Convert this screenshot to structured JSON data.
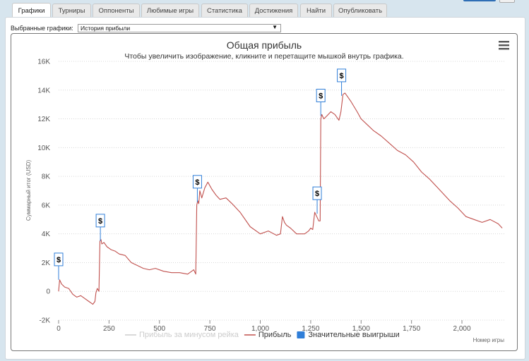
{
  "tabs": [
    {
      "label": "Графики",
      "active": true
    },
    {
      "label": "Турниры",
      "active": false
    },
    {
      "label": "Оппоненты",
      "active": false
    },
    {
      "label": "Любимые игры",
      "active": false
    },
    {
      "label": "Статистика",
      "active": false
    },
    {
      "label": "Достижения",
      "active": false
    },
    {
      "label": "Найти",
      "active": false
    },
    {
      "label": "Опубликовать",
      "active": false
    }
  ],
  "selector": {
    "label": "Выбранные графики:",
    "value": "История прибыли"
  },
  "colors": {
    "profit_line": "#c0504d",
    "rake_line": "#cccccc",
    "big_wins": "#2f7ed8",
    "tab_bg": "#e9e9e9",
    "page_bg": "#d7e5ee"
  },
  "chart_data": {
    "type": "line",
    "title": "Общая прибыль",
    "subtitle": "Чтобы увеличить изображение, кликните и перетащите мышкой внутрь графика.",
    "xlabel": "Номер игры",
    "ylabel": "Суммарный итог (USD)",
    "xlim": [
      0,
      2210
    ],
    "ylim": [
      -2000,
      16000
    ],
    "x_ticks": [
      0,
      250,
      500,
      750,
      1000,
      1250,
      1500,
      1750,
      2000
    ],
    "x_tick_labels": [
      "0",
      "250",
      "500",
      "750",
      "1,000",
      "1,250",
      "1,500",
      "1,750",
      "2,000"
    ],
    "y_ticks": [
      -2000,
      0,
      2000,
      4000,
      6000,
      8000,
      10000,
      12000,
      14000,
      16000
    ],
    "y_tick_labels": [
      "-2K",
      "0",
      "2K",
      "4K",
      "6K",
      "8K",
      "10K",
      "12K",
      "14K",
      "16K"
    ],
    "grid": true,
    "legend_position": "bottom",
    "legend": [
      {
        "name": "Прибыль за минусом рейка",
        "style": "line",
        "color": "#cccccc",
        "muted": true
      },
      {
        "name": "Прибыль",
        "style": "line",
        "color": "#c0504d",
        "muted": false
      },
      {
        "name": "Значительные выигрыши",
        "style": "square",
        "color": "#2f7ed8",
        "muted": false
      }
    ],
    "series": [
      {
        "name": "Прибыль",
        "x": [
          0,
          5,
          15,
          30,
          50,
          70,
          90,
          110,
          130,
          150,
          170,
          180,
          185,
          192,
          200,
          205,
          210,
          214,
          225,
          240,
          260,
          280,
          300,
          330,
          360,
          390,
          420,
          450,
          480,
          520,
          560,
          600,
          640,
          670,
          680,
          685,
          690,
          695,
          700,
          710,
          725,
          740,
          760,
          780,
          800,
          830,
          860,
          900,
          950,
          1000,
          1040,
          1080,
          1100,
          1110,
          1120,
          1130,
          1150,
          1180,
          1220,
          1240,
          1250,
          1260,
          1270,
          1280,
          1290,
          1297,
          1300,
          1305,
          1315,
          1330,
          1350,
          1370,
          1390,
          1395,
          1400,
          1410,
          1420,
          1430,
          1450,
          1480,
          1500,
          1530,
          1560,
          1600,
          1640,
          1680,
          1720,
          1760,
          1800,
          1840,
          1880,
          1900,
          1940,
          1980,
          2020,
          2060,
          2100,
          2140,
          2180,
          2200
        ],
        "y": [
          0,
          800,
          500,
          300,
          200,
          -200,
          -400,
          -300,
          -500,
          -700,
          -900,
          -700,
          -100,
          200,
          0,
          3500,
          3600,
          3300,
          3400,
          3100,
          2900,
          2800,
          2600,
          2500,
          2000,
          1800,
          1600,
          1500,
          1600,
          1400,
          1300,
          1300,
          1200,
          1500,
          1200,
          6000,
          6300,
          6100,
          7000,
          6500,
          7200,
          7600,
          7100,
          6700,
          6400,
          6500,
          6100,
          5500,
          4500,
          4000,
          4200,
          3900,
          4000,
          5200,
          4800,
          4600,
          4400,
          4000,
          4000,
          4200,
          4400,
          4300,
          5500,
          5200,
          4900,
          4900,
          12000,
          12300,
          12000,
          12200,
          12500,
          12300,
          11900,
          12200,
          12500,
          13700,
          13800,
          13600,
          13200,
          12500,
          12000,
          11600,
          11200,
          10800,
          10300,
          9800,
          9500,
          9000,
          8300,
          7800,
          7200,
          6900,
          6300,
          5800,
          5200,
          5000,
          4800,
          5000,
          4700,
          4400
        ]
      }
    ],
    "markers": [
      {
        "x": 0,
        "y": 800,
        "label": "$"
      },
      {
        "x": 207,
        "y": 3500,
        "label": "$"
      },
      {
        "x": 688,
        "y": 6200,
        "label": "$"
      },
      {
        "x": 1282,
        "y": 5400,
        "label": "$"
      },
      {
        "x": 1300,
        "y": 12200,
        "label": "$"
      },
      {
        "x": 1403,
        "y": 13600,
        "label": "$"
      }
    ]
  }
}
